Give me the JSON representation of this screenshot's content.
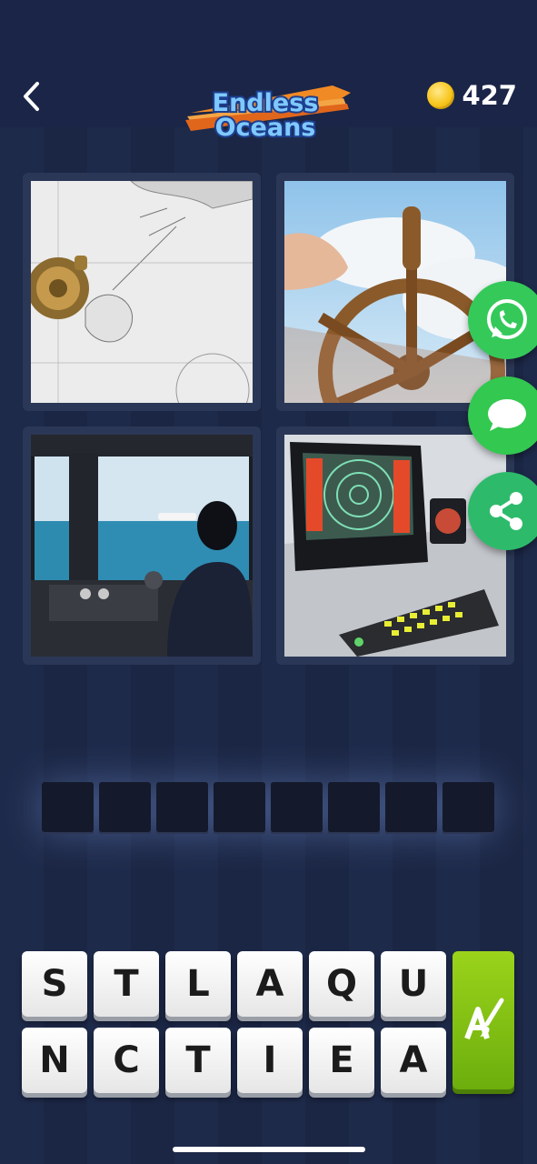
{
  "header": {
    "logo_line1": "Endless",
    "logo_line2": "Oceans",
    "coins": "427"
  },
  "images": [
    {
      "name": "nautical-chart-compass"
    },
    {
      "name": "ships-wheel"
    },
    {
      "name": "boat-bridge-captain"
    },
    {
      "name": "radar-console"
    }
  ],
  "share": {
    "whatsapp": "whatsapp-icon",
    "messages": "message-icon",
    "share": "share-icon"
  },
  "answer_slots": 8,
  "letters": {
    "row1": [
      "S",
      "T",
      "L",
      "A",
      "Q",
      "U"
    ],
    "row2": [
      "N",
      "C",
      "T",
      "I",
      "E",
      "A"
    ]
  },
  "hint_icon": "brush-a-icon"
}
